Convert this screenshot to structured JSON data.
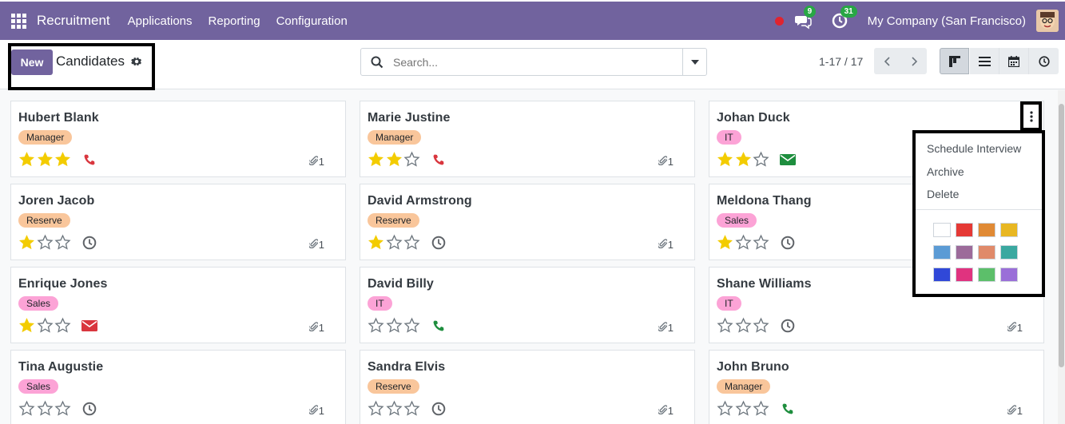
{
  "nav": {
    "app_name": "Recruitment",
    "menus": [
      "Applications",
      "Reporting",
      "Configuration"
    ],
    "messages_badge": "9",
    "activities_badge": "31",
    "company": "My Company (San Francisco)"
  },
  "control": {
    "new_label": "New",
    "breadcrumb": "Candidates",
    "search_placeholder": "Search...",
    "pager": "1-17 / 17"
  },
  "colors": {
    "brand": "#71639e",
    "tag_manager": "#f9c69b",
    "tag_reserve": "#f9c69b",
    "tag_sales": "#fca3d6",
    "tag_it": "#fca3d6",
    "star_on": "#f3cc00"
  },
  "cards": [
    {
      "name": "Hubert Blank",
      "tag": "Manager",
      "stars": 3,
      "activity": "phone-red-icon",
      "attachments": "1"
    },
    {
      "name": "Marie Justine",
      "tag": "Manager",
      "stars": 2,
      "activity": "phone-red-icon",
      "attachments": "1"
    },
    {
      "name": "Johan Duck",
      "tag": "IT",
      "stars": 2,
      "activity": "envelope-green-icon",
      "attachments": ""
    },
    {
      "name": "Joren Jacob",
      "tag": "Reserve",
      "stars": 1,
      "activity": "clock-icon",
      "attachments": "1"
    },
    {
      "name": "David Armstrong",
      "tag": "Reserve",
      "stars": 1,
      "activity": "clock-icon",
      "attachments": "1"
    },
    {
      "name": "Meldona Thang",
      "tag": "Sales",
      "stars": 1,
      "activity": "clock-icon",
      "attachments": ""
    },
    {
      "name": "Enrique Jones",
      "tag": "Sales",
      "stars": 1,
      "activity": "envelope-red-icon",
      "attachments": "1"
    },
    {
      "name": "David Billy",
      "tag": "IT",
      "stars": 0,
      "activity": "phone-green-icon",
      "attachments": "1"
    },
    {
      "name": "Shane Williams",
      "tag": "IT",
      "stars": 0,
      "activity": "clock-icon",
      "attachments": "1"
    },
    {
      "name": "Tina Augustie",
      "tag": "Sales",
      "stars": 0,
      "activity": "clock-icon",
      "attachments": "1"
    },
    {
      "name": "Sandra Elvis",
      "tag": "Reserve",
      "stars": 0,
      "activity": "clock-icon",
      "attachments": "1"
    },
    {
      "name": "John Bruno",
      "tag": "Manager",
      "stars": 0,
      "activity": "phone-green-icon",
      "attachments": "1"
    }
  ],
  "dropdown": {
    "items": [
      "Schedule Interview",
      "Archive",
      "Delete"
    ],
    "swatches": [
      "#ffffff",
      "#e53935",
      "#e08a35",
      "#e8b722",
      "#5b9bd5",
      "#9c6b9a",
      "#e08a6a",
      "#3aa8a0",
      "#3048d8",
      "#e0337f",
      "#5cbf6a",
      "#9a6fd8"
    ]
  }
}
